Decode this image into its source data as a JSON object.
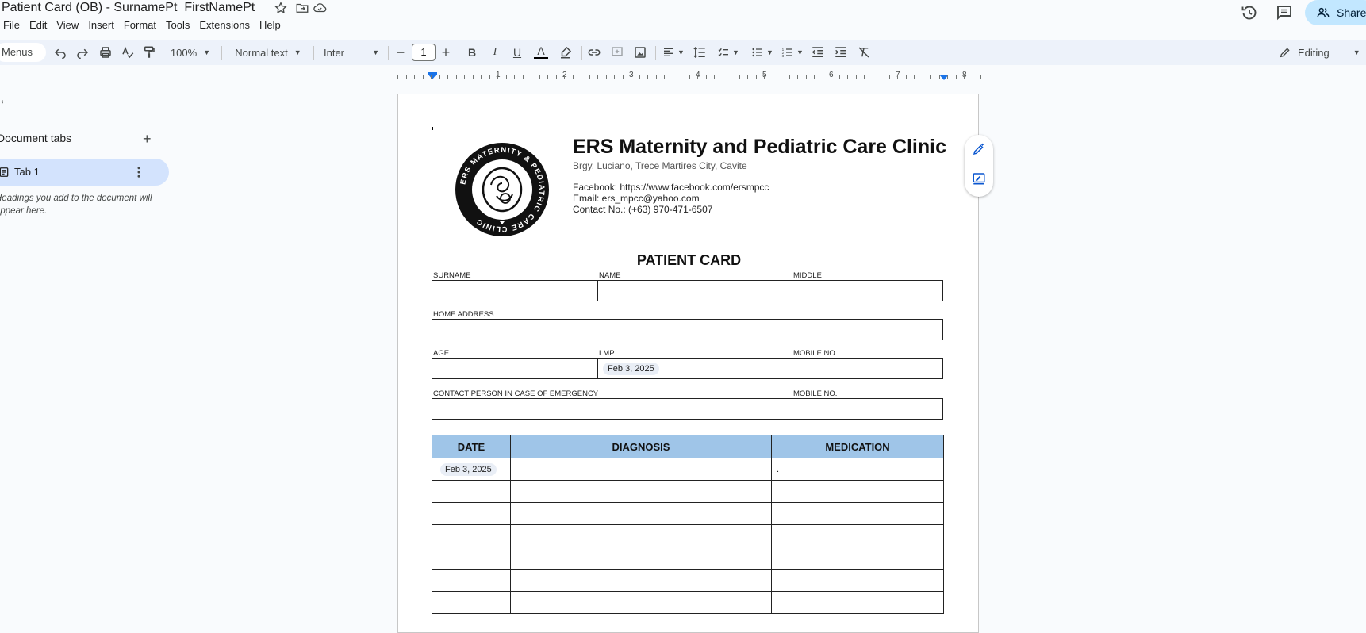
{
  "title_bar": {
    "doc_title": "Patient Card (OB) - SurnamePt_FirstNamePt",
    "share_label": "Share"
  },
  "menu": [
    "File",
    "Edit",
    "View",
    "Insert",
    "Format",
    "Tools",
    "Extensions",
    "Help"
  ],
  "toolbar": {
    "menus_label": "Menus",
    "zoom": "100%",
    "style": "Normal text",
    "font": "Inter",
    "font_size": "1",
    "mode": "Editing"
  },
  "ruler": {
    "numbers": [
      "1",
      "2",
      "3",
      "4",
      "5",
      "6",
      "7",
      "8"
    ]
  },
  "sidebar": {
    "heading": "Document tabs",
    "tab_label": "Tab 1",
    "hint": "Headings you add to the document will appear here."
  },
  "document": {
    "clinic_name": "ERS Maternity and Pediatric Care Clinic",
    "address": "Brgy. Luciano, Trece Martires City, Cavite",
    "facebook": "Facebook: https://www.facebook.com/ersmpcc",
    "email": "Email: ers_mpcc@yahoo.com",
    "contact": "Contact No.: (+63) 970-471-6507",
    "logo_text": "ERS MATERNITY & PEDIATRIC CARE CLINIC",
    "card_title": "PATIENT CARD",
    "labels": {
      "surname": "SURNAME",
      "name": "NAME",
      "middle": "MIDDLE",
      "home_address": "HOME ADDRESS",
      "age": "AGE",
      "lmp": "LMP",
      "mobile": "MOBILE NO.",
      "emergency": "CONTACT PERSON IN CASE OF EMERGENCY",
      "mobile2": "MOBILE NO."
    },
    "lmp_value": "Feb 3, 2025",
    "table": {
      "headers": [
        "DATE",
        "DIAGNOSIS",
        "MEDICATION"
      ],
      "first_date": "Feb 3, 2025",
      "first_med": "."
    }
  },
  "colors": {
    "table_header": "#9fc5e8",
    "share_bg": "#c2e7ff",
    "tab_selected": "#d3e3fd",
    "accent": "#0b57d0"
  }
}
